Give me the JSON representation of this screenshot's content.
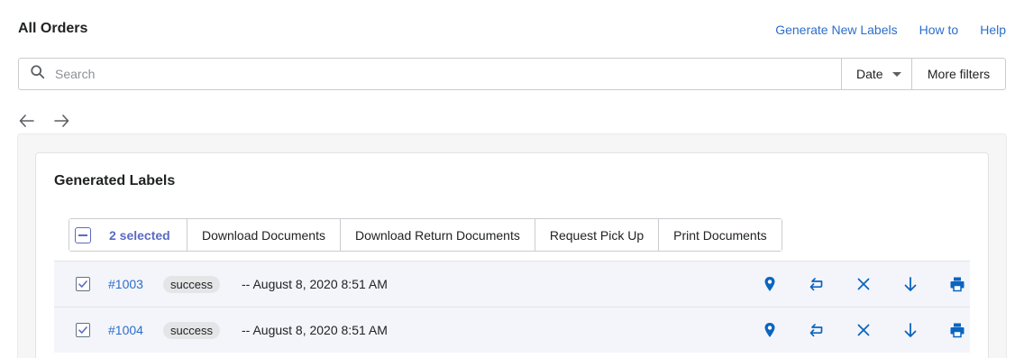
{
  "header": {
    "title": "All Orders",
    "links": [
      "Generate New Labels",
      "How to",
      "Help"
    ]
  },
  "search": {
    "placeholder": "Search",
    "value": ""
  },
  "filters": {
    "date_label": "Date",
    "more_label": "More filters"
  },
  "card": {
    "title": "Generated Labels"
  },
  "bulk_actions": {
    "selected_label": "2 selected",
    "buttons": [
      "Download Documents",
      "Download Return Documents",
      "Request Pick Up",
      "Print Documents"
    ]
  },
  "orders": [
    {
      "id": "#1003",
      "status": "success",
      "date": "-- August 8, 2020 8:51 AM",
      "checked": true
    },
    {
      "id": "#1004",
      "status": "success",
      "date": "-- August 8, 2020 8:51 AM",
      "checked": true
    }
  ],
  "colors": {
    "accent": "#2c6ecb",
    "selection": "#5c6ac4",
    "icon_blue": "#0a65c0"
  },
  "icons": {
    "search": "search-icon",
    "back": "arrow-left-icon",
    "forward": "arrow-right-icon",
    "row_actions": [
      "location-pin-icon",
      "return-icon",
      "close-icon",
      "download-icon",
      "print-icon"
    ]
  }
}
